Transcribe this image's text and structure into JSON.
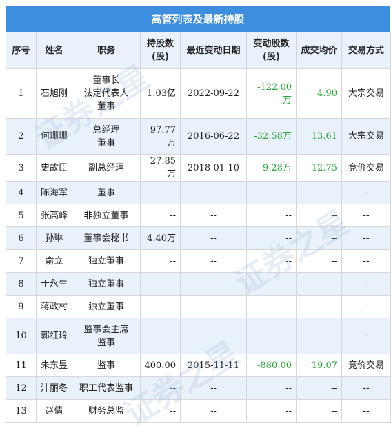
{
  "title": "高管列表及最新持股",
  "headers": {
    "seq": "序号",
    "name": "姓名",
    "position": "职务",
    "shares": [
      "持股数",
      "(股)"
    ],
    "date": "最近变动日期",
    "change": [
      "变动股数",
      "(股)"
    ],
    "price": "成交均价",
    "method": "交易方式"
  },
  "rows": [
    {
      "seq": "1",
      "name": "石旭刚",
      "position": [
        "董事长",
        "法定代表人",
        "董事"
      ],
      "shares": "1.03亿",
      "date": "2022-09-22",
      "change": "-122.00万",
      "price": "4.90",
      "method": "大宗交易"
    },
    {
      "seq": "2",
      "name": "何珊珊",
      "position": [
        "总经理",
        "董事"
      ],
      "shares": "97.77万",
      "date": "2016-06-22",
      "change": "-32.58万",
      "price": "13.61",
      "method": "大宗交易"
    },
    {
      "seq": "3",
      "name": "史故臣",
      "position": [
        "副总经理"
      ],
      "shares": "27.85万",
      "date": "2018-01-10",
      "change": "-9.28万",
      "price": "12.75",
      "method": "竞价交易"
    },
    {
      "seq": "4",
      "name": "陈海军",
      "position": [
        "董事"
      ],
      "shares": "--",
      "date": "--",
      "change": "--",
      "price": "--",
      "method": "--"
    },
    {
      "seq": "5",
      "name": "张高峰",
      "position": [
        "非独立董事"
      ],
      "shares": "--",
      "date": "--",
      "change": "--",
      "price": "--",
      "method": "--"
    },
    {
      "seq": "6",
      "name": "孙琳",
      "position": [
        "董事会秘书"
      ],
      "shares": "4.40万",
      "date": "--",
      "change": "--",
      "price": "--",
      "method": "--"
    },
    {
      "seq": "7",
      "name": "俞立",
      "position": [
        "独立董事"
      ],
      "shares": "--",
      "date": "--",
      "change": "--",
      "price": "--",
      "method": "--"
    },
    {
      "seq": "8",
      "name": "于永生",
      "position": [
        "独立董事"
      ],
      "shares": "--",
      "date": "--",
      "change": "--",
      "price": "--",
      "method": "--"
    },
    {
      "seq": "9",
      "name": "蒋政村",
      "position": [
        "独立董事"
      ],
      "shares": "--",
      "date": "--",
      "change": "--",
      "price": "--",
      "method": "--"
    },
    {
      "seq": "10",
      "name": "郭红玲",
      "position": [
        "监事会主席",
        "监事"
      ],
      "shares": "--",
      "date": "--",
      "change": "--",
      "price": "--",
      "method": "--"
    },
    {
      "seq": "11",
      "name": "朱东昱",
      "position": [
        "监事"
      ],
      "shares": "400.00",
      "date": "2015-11-11",
      "change": "-880.00",
      "price": "19.07",
      "method": "竞价交易"
    },
    {
      "seq": "12",
      "name": "沣丽冬",
      "position": [
        "职工代表监事"
      ],
      "shares": "--",
      "date": "--",
      "change": "--",
      "price": "--",
      "method": "--"
    },
    {
      "seq": "13",
      "name": "赵倩",
      "position": [
        "财务总监"
      ],
      "shares": "--",
      "date": "--",
      "change": "--",
      "price": "--",
      "method": "--"
    }
  ],
  "colors": {
    "header_bar": "#3e8ee0",
    "header_row": "#e9f2fb",
    "alt_row": "#e9f2fb",
    "value_green": "#2aa63a"
  },
  "watermark": "证券之星"
}
